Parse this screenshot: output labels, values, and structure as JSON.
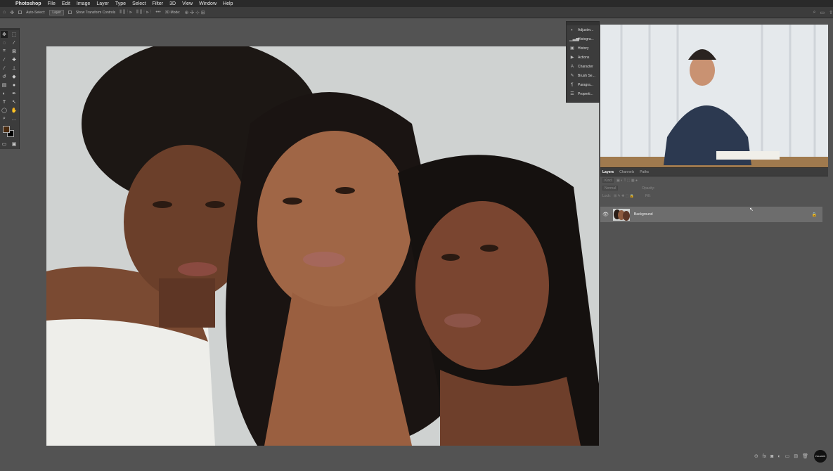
{
  "menubar": {
    "apple": "",
    "app": "Photoshop",
    "items": [
      "File",
      "Edit",
      "Image",
      "Layer",
      "Type",
      "Select",
      "Filter",
      "3D",
      "View",
      "Window",
      "Help"
    ]
  },
  "options": {
    "auto_select_label": "Auto-Select:",
    "auto_select_value": "Layer",
    "transform_label": "Show Transform Controls",
    "mode_label": "3D Mode:"
  },
  "panels": [
    {
      "icon": "adjustments-icon",
      "label": "Adjustm..."
    },
    {
      "icon": "histogram-icon",
      "label": "Histogra..."
    },
    {
      "icon": "history-icon",
      "label": "History"
    },
    {
      "icon": "actions-icon",
      "label": "Actions"
    },
    {
      "icon": "character-icon",
      "label": "Character"
    },
    {
      "icon": "brush-settings-icon",
      "label": "Brush Se..."
    },
    {
      "icon": "paragraph-icon",
      "label": "Paragra..."
    },
    {
      "icon": "properties-icon",
      "label": "Properti..."
    }
  ],
  "layers_panel": {
    "tabs": [
      "Layers",
      "Channels",
      "Paths"
    ],
    "filter_placeholder": "Kind",
    "blend_mode": "Normal",
    "opacity_label": "Opacity:",
    "lock_label": "Lock:",
    "fill_label": "Fill:",
    "layer_name": "Background"
  },
  "logo_text": "PHLEARN",
  "colors": {
    "foreground": "#4a2a0e",
    "background": "#000000",
    "accent": "#6d6d6d"
  }
}
